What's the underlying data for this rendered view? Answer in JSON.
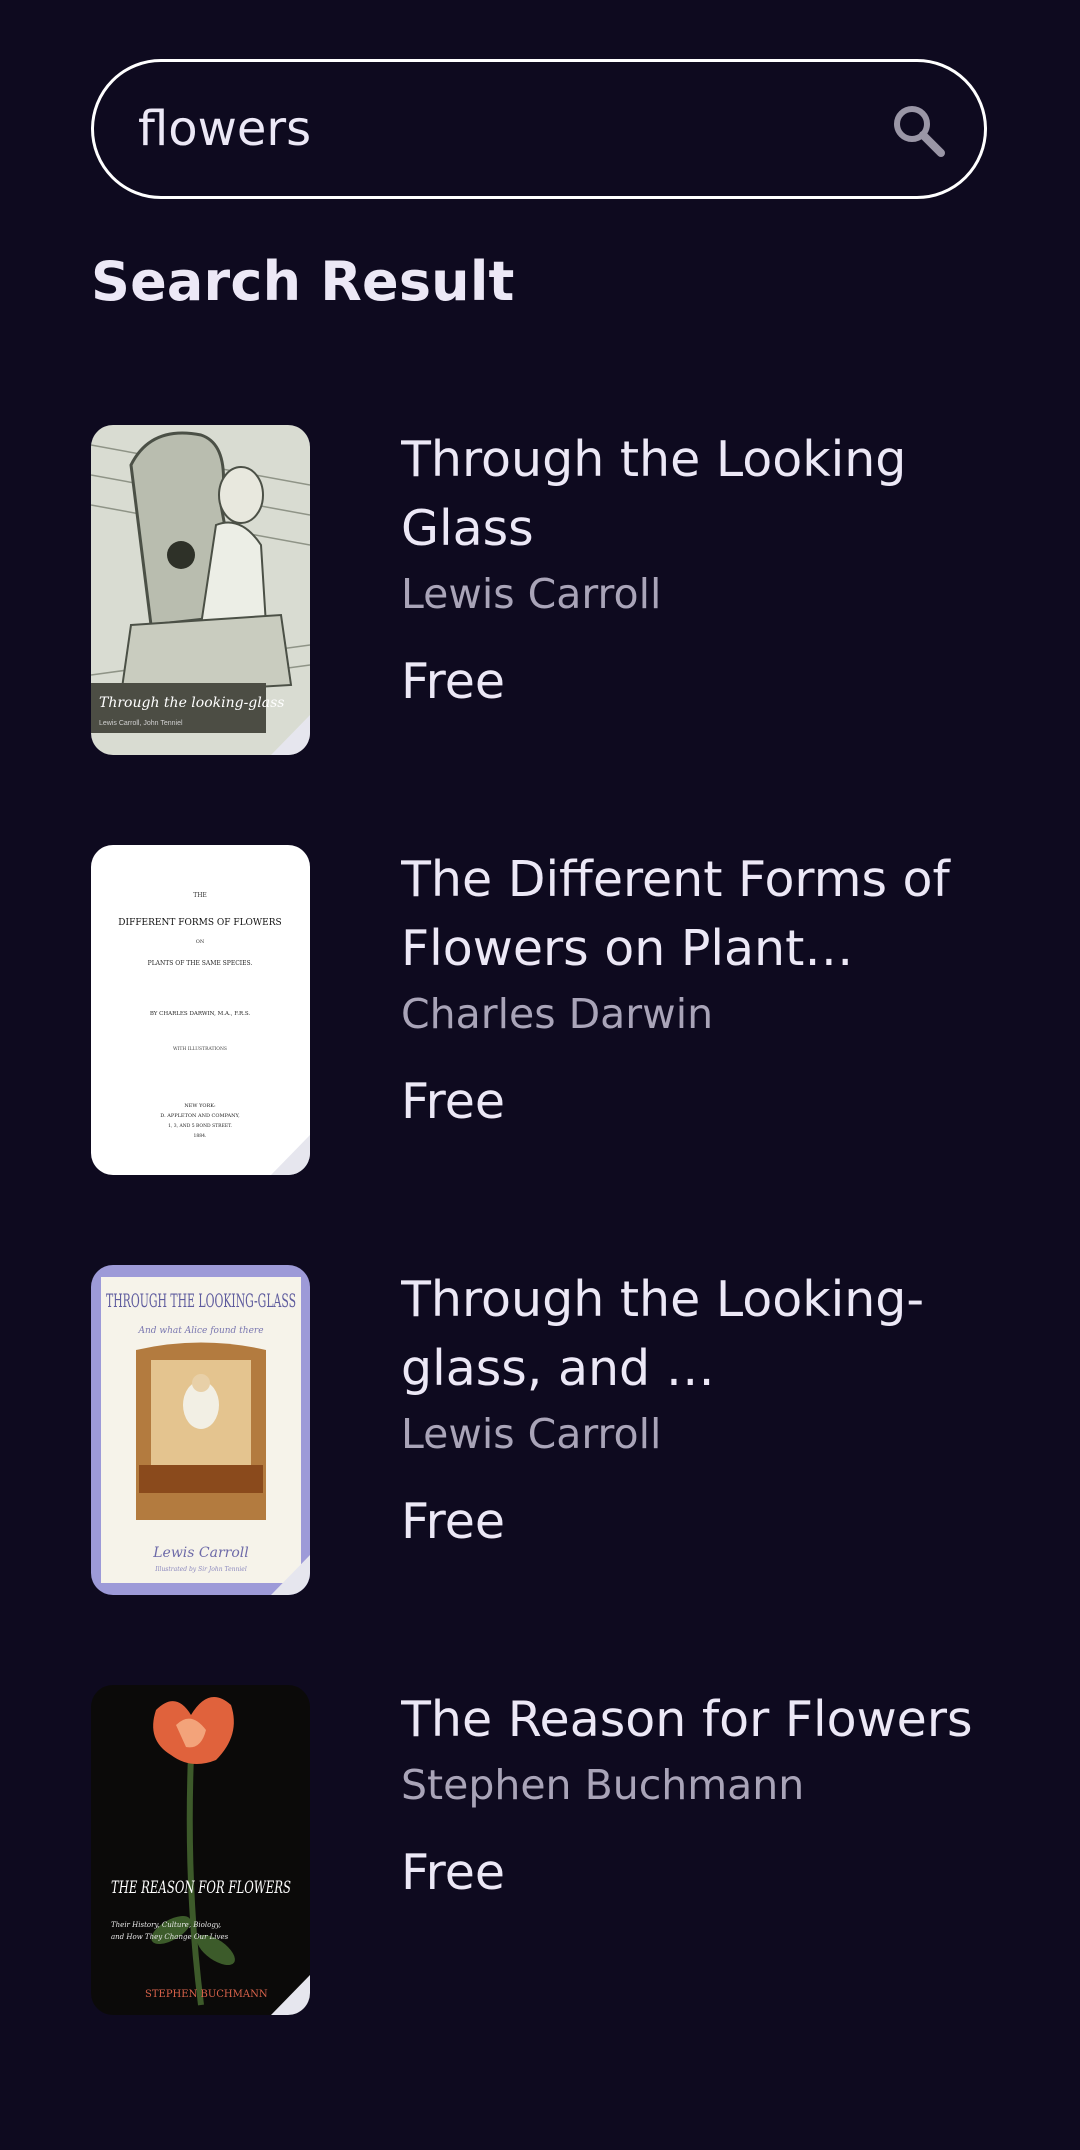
{
  "search": {
    "value": "flowers",
    "icon": "search-icon"
  },
  "section_title": "Search Result",
  "books": [
    {
      "title": "Through the Looking Glass",
      "author": "Lewis Carroll",
      "price": "Free",
      "cover_text": "Through the looking-glass",
      "cover_subtext": "Lewis Carroll, John Tenniel"
    },
    {
      "title": "The Different Forms of Flowers on Plant…",
      "author": "Charles Darwin",
      "price": "Free",
      "cover_text": "DIFFERENT FORMS OF FLOWERS",
      "cover_subtext": "BY CHARLES DARWIN, M.A., F.R.S."
    },
    {
      "title": "Through the Looking-glass, and …",
      "author": "Lewis Carroll",
      "price": "Free",
      "cover_text": "THROUGH THE LOOKING-GLASS",
      "cover_subtext": "Lewis Carroll"
    },
    {
      "title": "The Reason for Flowers",
      "author": "Stephen Buchmann",
      "price": "Free",
      "cover_text": "THE REASON FOR FLOWERS",
      "cover_subtext": "STEPHEN BUCHMANN"
    }
  ],
  "colors": {
    "background": "#0e0a1f",
    "text": "#ece8f6",
    "muted": "#a9a4b8"
  }
}
